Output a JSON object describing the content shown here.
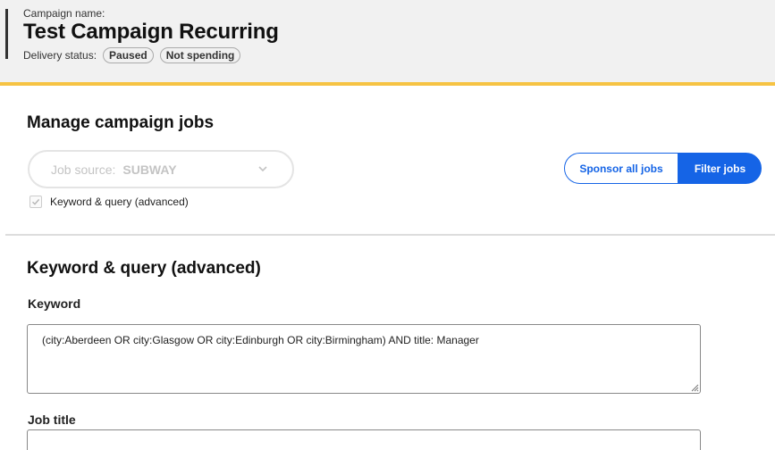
{
  "campaign": {
    "name_label": "Campaign name:",
    "name": "Test Campaign Recurring",
    "delivery_status_label": "Delivery status:",
    "badges": [
      "Paused",
      "Not spending"
    ]
  },
  "manage": {
    "title": "Manage campaign jobs",
    "job_source_label": "Job source:",
    "job_source_value": "SUBWAY",
    "checkbox_label": "Keyword & query (advanced)",
    "checkbox_checked": true,
    "sponsor_all_label": "Sponsor all jobs",
    "filter_jobs_label": "Filter jobs"
  },
  "query": {
    "title": "Keyword & query (advanced)",
    "keyword_label": "Keyword",
    "keyword_value": "(city:Aberdeen OR city:Glasgow OR city:Edinburgh OR city:Birmingham) AND title: Manager",
    "job_title_label": "Job title",
    "job_title_value": ""
  },
  "colors": {
    "accent": "#1564e6",
    "header_border": "#f6c343",
    "header_bg": "#f1f1f1"
  }
}
